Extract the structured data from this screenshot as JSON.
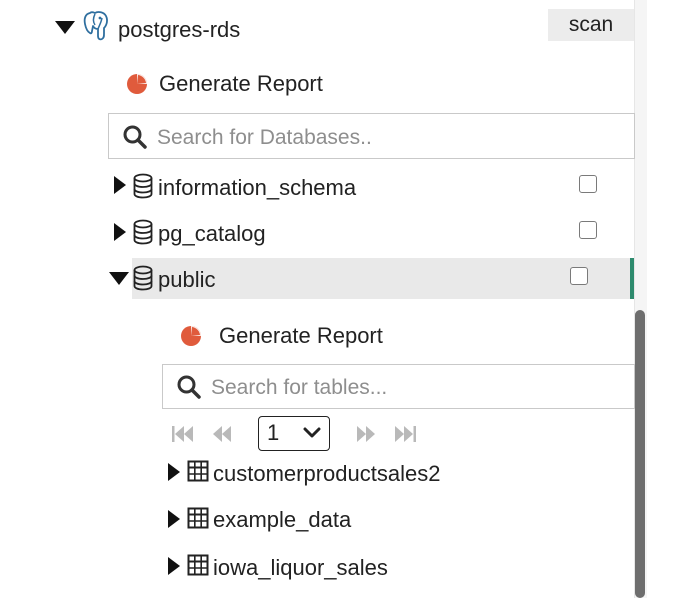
{
  "colors": {
    "report_icon": "#e05b3c",
    "selected_row_bg": "#e9e9e9",
    "selected_accent": "#2e8b6e",
    "placeholder_text": "#8e8e8e"
  },
  "icons": {
    "connection": "postgres-elephant-icon",
    "report": "pie-chart-icon",
    "search": "search-icon",
    "database": "database-icon",
    "table": "table-grid-icon"
  },
  "connection": {
    "name": "postgres-rds",
    "scan_label": "scan",
    "generate_report_label": "Generate Report",
    "search_placeholder": "Search for Databases.."
  },
  "databases": [
    {
      "name": "information_schema",
      "expanded": false,
      "checked": false
    },
    {
      "name": "pg_catalog",
      "expanded": false,
      "checked": false
    },
    {
      "name": "public",
      "expanded": true,
      "checked": false,
      "selected": true
    }
  ],
  "public_schema": {
    "generate_report_label": "Generate Report",
    "search_placeholder": "Search for tables...",
    "pagination": {
      "current_page": "1"
    },
    "tables": [
      {
        "name": "customerproductsales2"
      },
      {
        "name": "example_data"
      },
      {
        "name": "iowa_liquor_sales"
      }
    ]
  }
}
